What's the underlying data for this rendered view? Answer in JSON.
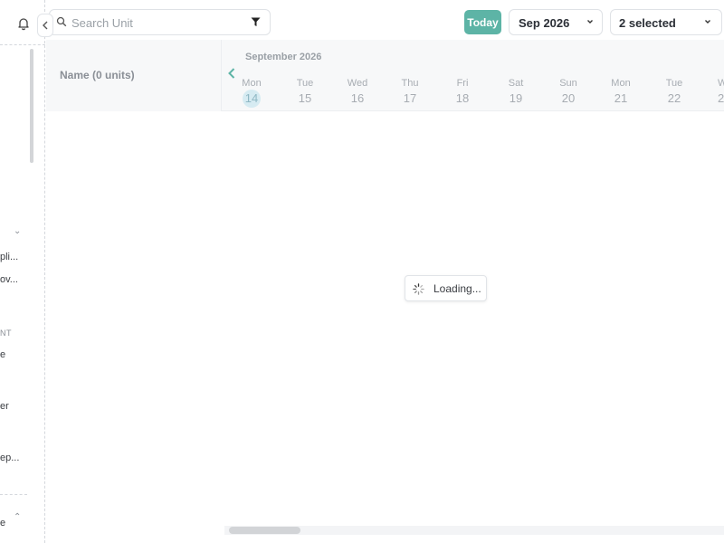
{
  "sidebar": {
    "items": [
      {
        "label": "pli..."
      },
      {
        "label": "ov..."
      },
      {
        "label": "e"
      },
      {
        "label": "er"
      },
      {
        "label": "ep..."
      },
      {
        "label": "e"
      }
    ],
    "section_label": "NT"
  },
  "search": {
    "placeholder": "Search Unit",
    "value": ""
  },
  "toolbar": {
    "today_label": "Today",
    "month_value": "Sep 2026",
    "units_value": "2 selected"
  },
  "calendar": {
    "name_header": "Name (0 units)",
    "month_label": "September 2026",
    "days": [
      {
        "name": "Mon",
        "num": "14"
      },
      {
        "name": "Tue",
        "num": "15"
      },
      {
        "name": "Wed",
        "num": "16"
      },
      {
        "name": "Thu",
        "num": "17"
      },
      {
        "name": "Fri",
        "num": "18"
      },
      {
        "name": "Sat",
        "num": "19"
      },
      {
        "name": "Sun",
        "num": "20"
      },
      {
        "name": "Mon",
        "num": "21"
      },
      {
        "name": "Tue",
        "num": "22"
      },
      {
        "name": "W",
        "num": "2"
      }
    ]
  },
  "status": {
    "loading_label": "Loading..."
  },
  "colors": {
    "accent": "#5db4a6",
    "today_highlight": "#d6ebf2"
  },
  "icons": [
    "bell-icon",
    "chevron-left-icon",
    "search-icon",
    "filter-icon",
    "chevron-down-icon",
    "spinner-icon",
    "chevron-up-icon"
  ]
}
